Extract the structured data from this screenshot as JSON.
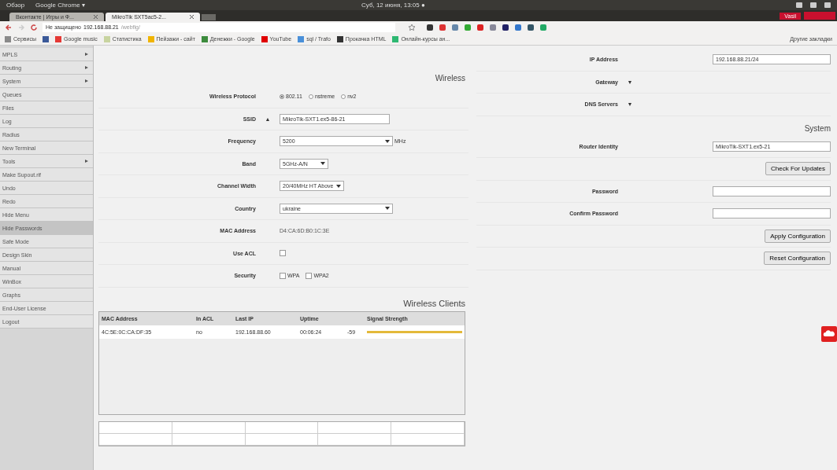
{
  "desktop_panel": {
    "activities": "Обзор",
    "app_menu": "Google Chrome ▾",
    "clock": "Суб, 12 июня, 13:05 ●",
    "user": "Vasil"
  },
  "browser": {
    "tabs": [
      {
        "title": "Вконтакте | Игры и Ф...",
        "selected": false
      },
      {
        "title": "MikroTik SXT5ac5-2...",
        "selected": true
      }
    ],
    "address": {
      "security": "Не защищено",
      "host": "192.168.88.21",
      "path": "/webfig/"
    },
    "bookmarks": [
      {
        "label": "Сервисы",
        "color": "#8a8a8a"
      },
      {
        "color": "#3b5998"
      },
      {
        "label": "Google music",
        "color": "#e53935"
      },
      {
        "label": "Статистика",
        "color": "#c8d4a0"
      },
      {
        "label": "Пейзажи - сайт",
        "color": "#f0b400"
      },
      {
        "label": "Денежки - Google",
        "color": "#3d8b3d"
      },
      {
        "label": "YouTube",
        "color": "#e00000"
      },
      {
        "label": "sql / Trafo",
        "color": "#4a90d9"
      },
      {
        "label": "Прокачка HTML",
        "color": "#333333"
      },
      {
        "label": "Онлайн-курсы ан...",
        "color": "#2eb872"
      }
    ],
    "other_bookmarks": "Другие закладки"
  },
  "sidebar": {
    "items": [
      {
        "label": "MPLS",
        "submenu": true,
        "selected": false
      },
      {
        "label": "Routing",
        "submenu": true,
        "selected": false
      },
      {
        "label": "System",
        "submenu": true,
        "selected": false
      },
      {
        "label": "Queues",
        "submenu": false,
        "selected": false
      },
      {
        "label": "Files",
        "submenu": false,
        "selected": false
      },
      {
        "label": "Log",
        "submenu": false,
        "selected": false
      },
      {
        "label": "Radius",
        "submenu": false,
        "selected": false
      },
      {
        "label": "New Terminal",
        "submenu": false,
        "selected": false
      },
      {
        "label": "Tools",
        "submenu": true,
        "selected": false
      },
      {
        "label": "Make Supout.rif",
        "submenu": false,
        "selected": false
      },
      {
        "label": "Undo",
        "submenu": false,
        "selected": false
      },
      {
        "label": "Redo",
        "submenu": false,
        "selected": false
      },
      {
        "label": "Hide Menu",
        "submenu": false,
        "selected": false
      },
      {
        "label": "Hide Passwords",
        "submenu": false,
        "selected": true
      },
      {
        "label": "Safe Mode",
        "submenu": false,
        "selected": false
      },
      {
        "label": "Design Skin",
        "submenu": false,
        "selected": false
      },
      {
        "label": "Manual",
        "submenu": false,
        "selected": false
      },
      {
        "label": "WinBox",
        "submenu": false,
        "selected": false
      },
      {
        "label": "Graphs",
        "submenu": false,
        "selected": false
      },
      {
        "label": "End-User License",
        "submenu": false,
        "selected": false
      },
      {
        "label": "Logout",
        "submenu": false,
        "selected": false
      }
    ]
  },
  "wireless": {
    "heading": "Wireless",
    "rows": [
      {
        "kind": "radios",
        "label": "Wireless Protocol",
        "options": [
          {
            "label": "802.11",
            "selected": true
          },
          {
            "label": "nstreme",
            "selected": false
          },
          {
            "label": "nv2",
            "selected": false
          }
        ]
      },
      {
        "kind": "text",
        "label": "SSID",
        "value": "MikroTik-SXT1.ex5-86-21",
        "toggle": "▲"
      },
      {
        "kind": "select",
        "label": "Frequency",
        "value": "5200",
        "unit": "MHz",
        "wide": true
      },
      {
        "kind": "select",
        "label": "Band",
        "value": "5GHz-A/N",
        "wide": false
      },
      {
        "kind": "select",
        "label": "Channel Width",
        "value": "20/40MHz HT Above",
        "wide": false
      },
      {
        "kind": "select",
        "label": "Country",
        "value": "ukraine",
        "wide": true
      },
      {
        "kind": "static",
        "label": "MAC Address",
        "value": "D4:CA:6D:B0:1C:3E"
      },
      {
        "kind": "checks",
        "label": "Use ACL",
        "options": [
          {
            "checked": false
          }
        ]
      },
      {
        "kind": "checks",
        "label": "Security",
        "options": [
          {
            "label": "WPA",
            "checked": false
          },
          {
            "label": "WPA2",
            "checked": false
          }
        ]
      }
    ]
  },
  "clients": {
    "heading": "Wireless Clients",
    "columns": [
      "MAC Address",
      "In ACL",
      "Last IP",
      "Uptime",
      "",
      "Signal Strength"
    ],
    "rows": [
      {
        "mac": "4C:5E:0C:CA:DF:35",
        "in_acl": "no",
        "last_ip": "192.168.88.60",
        "uptime": "00:06:24",
        "signal": "-59",
        "level": 1.0
      }
    ]
  },
  "network": {
    "rows": [
      {
        "kind": "text",
        "label": "IP Address",
        "value": "192.168.88.21/24"
      },
      {
        "kind": "expand",
        "label": "Gateway",
        "toggle": "▼"
      },
      {
        "kind": "expand",
        "label": "DNS Servers",
        "toggle": "▼"
      }
    ]
  },
  "system": {
    "heading": "System",
    "rows": [
      {
        "kind": "text",
        "label": "Router Identity",
        "value": "MikroTik-SXT1.ex5-21"
      },
      {
        "kind": "button",
        "label": "Check For Updates"
      },
      {
        "kind": "password",
        "label": "Password"
      },
      {
        "kind": "password",
        "label": "Confirm Password"
      },
      {
        "kind": "button",
        "label": "Apply Configuration"
      },
      {
        "kind": "button",
        "label": "Reset Configuration"
      }
    ]
  }
}
